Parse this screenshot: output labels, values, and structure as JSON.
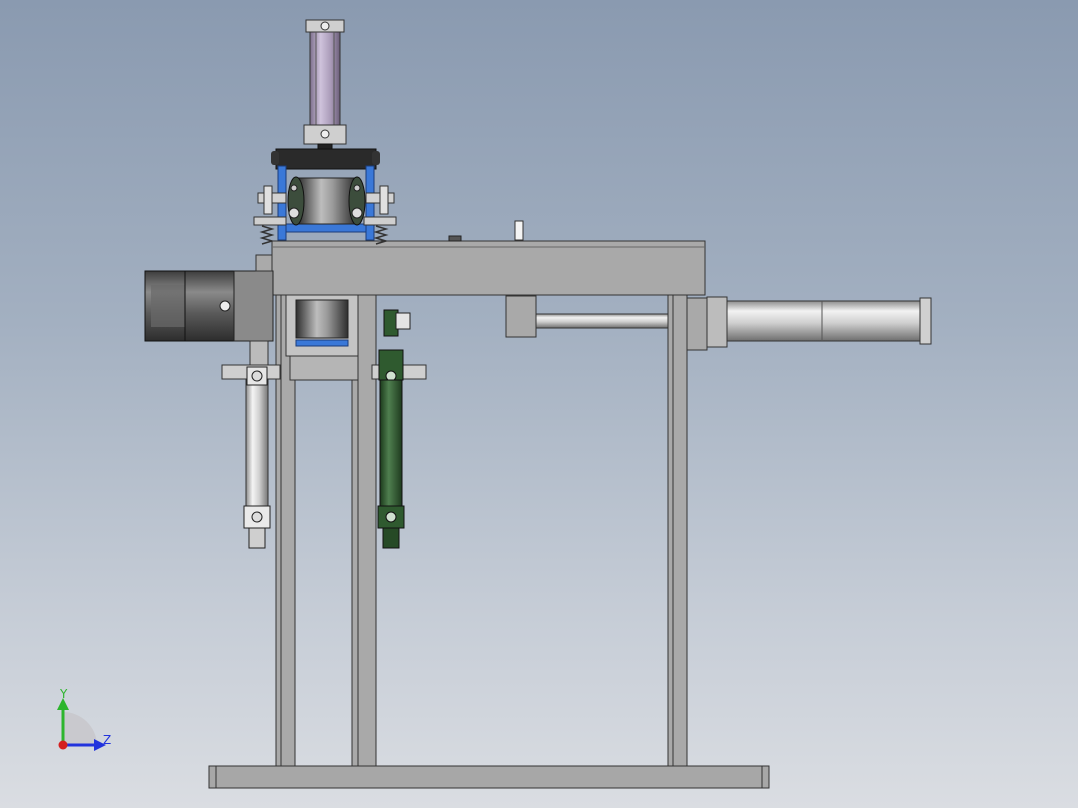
{
  "triad": {
    "y_label": "Y",
    "z_label": "Z",
    "colors": {
      "y_axis": "#2db52d",
      "z_axis": "#2233dd",
      "x_axis": "#d42020"
    }
  },
  "colors": {
    "background_top": "#8a9ab0",
    "background_bottom": "#dadde2",
    "frame_steel": "#a9a9a9",
    "cylinder_silver": "#d6d6d6",
    "motor_dark": "#4a4a4a",
    "bracket_blue": "#3a78d8",
    "cylinder_green": "#2f5a2f",
    "cylinder_purple": "#a99ab8"
  }
}
